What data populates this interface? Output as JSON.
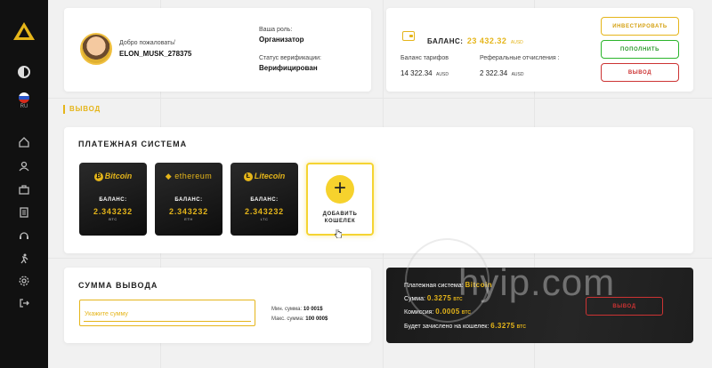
{
  "sidebar": {
    "logo": "logo-triangle",
    "language": "RU",
    "items": [
      "theme-toggle-icon",
      "language-flag-icon",
      "home-icon",
      "users-icon",
      "briefcase-icon",
      "document-icon",
      "support-icon",
      "running-icon",
      "settings-icon",
      "logout-icon"
    ]
  },
  "welcome": {
    "greeting": "Добро пожаловать/",
    "username": "ELON_MUSK_278375",
    "role_label": "Ваша роль:",
    "role_value": "Организатор",
    "verify_label": "Статус верификации:",
    "verify_value": "Верифицирован"
  },
  "balance": {
    "title": "БАЛАНС:",
    "amount": "23 432.32",
    "currency": "AUSD",
    "tariff_label": "Баланс тарифов",
    "tariff_value": "14 322.34",
    "tariff_currency": "AUSD",
    "referral_label": "Реферальные отчисления :",
    "referral_value": "2 322.34",
    "referral_currency": "AUSD",
    "invest_button": "ИНВЕСТИРОВАТЬ",
    "topup_button": "ПОПОЛНИТЬ",
    "withdraw_button": "ВЫВОД"
  },
  "section_title": "ВЫВОД",
  "payment": {
    "title": "ПЛАТЕЖНАЯ СИСТЕМА",
    "balance_label": "БАЛАНС:",
    "systems": [
      {
        "name": "Bitcoin",
        "value": "2.343232",
        "currency": "BTC"
      },
      {
        "name": "ethereum",
        "value": "2.343232",
        "currency": "ETH"
      },
      {
        "name": "Litecoin",
        "value": "2.343232",
        "currency": "LTC"
      }
    ],
    "add_wallet_line1": "ДОБАВИТЬ",
    "add_wallet_line2": "КОШЕЛЕК"
  },
  "withdraw_amount": {
    "title": "СУММА ВЫВОДА",
    "placeholder": "Укажите сумму",
    "min_label": "Мин. сумма:",
    "min_value": "10 001$",
    "max_label": "Макс. сумма:",
    "max_value": "100 000$"
  },
  "summary": {
    "system_label": "Платежная система:",
    "system_value": "Bitcoin",
    "sum_label": "Сумма:",
    "sum_value": "0.3275",
    "sum_currency": "BTC",
    "fee_label": "Комиссия:",
    "fee_value": "0.0005",
    "fee_currency": "BTC",
    "credited_label": "Будет зачислено на кошелек:",
    "credited_value": "6.3275",
    "credited_currency": "BTC",
    "withdraw_button": "ВЫВОД"
  },
  "watermark": "hyip.com",
  "colors": {
    "accent": "#e5b51a",
    "success": "#2bb52b",
    "danger": "#cc3333",
    "sidebar": "#111111"
  }
}
